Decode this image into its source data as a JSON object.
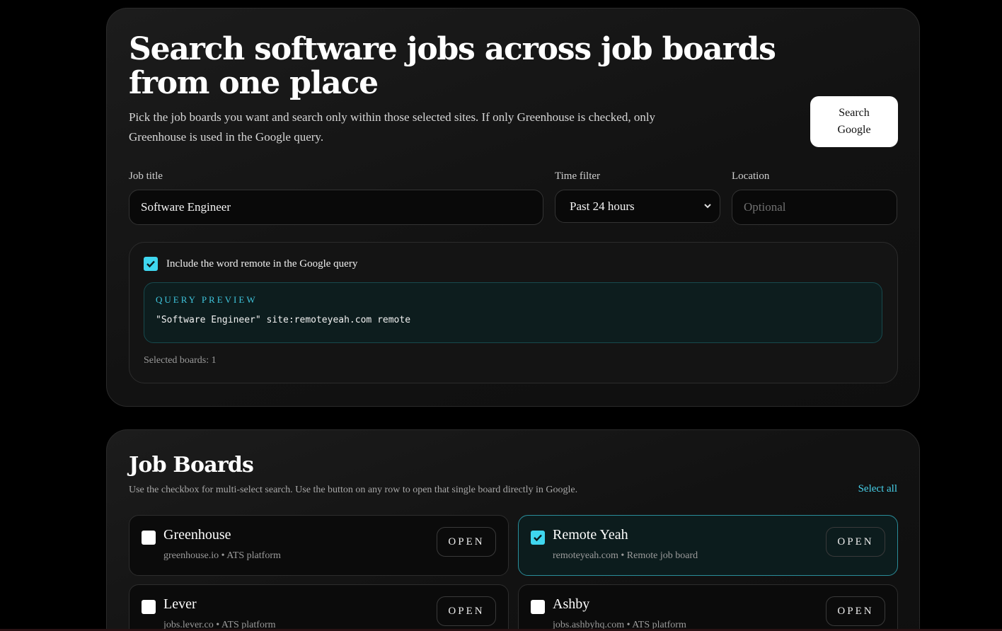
{
  "hero": {
    "title": "Search software jobs across job boards from one place",
    "intro": "Pick the job boards you want and search only within those selected sites. If only Greenhouse is checked, only Greenhouse is used in the Google query.",
    "search_button": "Search Google",
    "job_title_label": "Job title",
    "job_title_value": "Software Engineer",
    "time_filter_label": "Time filter",
    "time_filter_value": "Past 24 hours",
    "location_label": "Location",
    "location_placeholder": "Optional",
    "remote_checkbox_label": "Include the word remote in the Google query",
    "remote_checked": true,
    "preview_label": "QUERY PREVIEW",
    "preview_query": "\"Software Engineer\" site:remoteyeah.com remote",
    "selected_boards": "Selected boards: 1"
  },
  "boards": {
    "title": "Job Boards",
    "subtitle": "Use the checkbox for multi-select search. Use the button on any row to open that single board directly in Google.",
    "select_all": "Select all",
    "open_label": "OPEN",
    "items": [
      {
        "name": "Greenhouse",
        "meta": "greenhouse.io • ATS platform",
        "checked": false
      },
      {
        "name": "Remote Yeah",
        "meta": "remoteyeah.com • Remote job board",
        "checked": true
      },
      {
        "name": "Lever",
        "meta": "jobs.lever.co • ATS platform",
        "checked": false
      },
      {
        "name": "Ashby",
        "meta": "jobs.ashbyhq.com • ATS platform",
        "checked": false
      }
    ]
  },
  "colors": {
    "accent": "#3fd6ef",
    "background": "#000000",
    "card": "#151515"
  }
}
